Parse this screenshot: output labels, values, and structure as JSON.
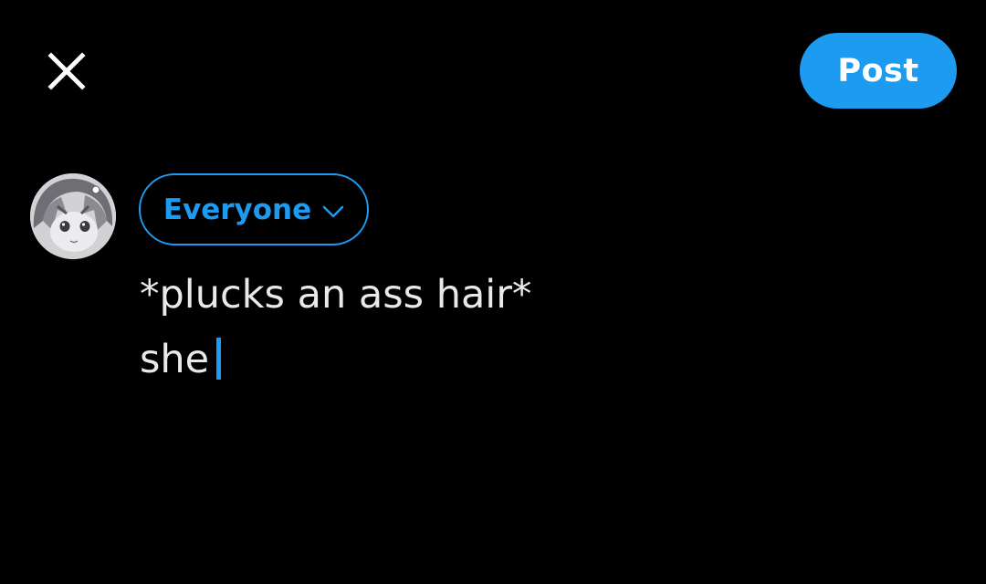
{
  "header": {
    "close_icon": "close-icon",
    "post_label": "Post"
  },
  "composer": {
    "avatar_icon": "user-avatar",
    "audience_label": "Everyone",
    "audience_icon": "chevron-down-icon",
    "text_lines": [
      "*plucks an ass hair*",
      "she"
    ]
  },
  "colors": {
    "background": "#000000",
    "accent": "#1d9bf0",
    "text": "#e7e9ea",
    "button_text": "#ffffff"
  }
}
